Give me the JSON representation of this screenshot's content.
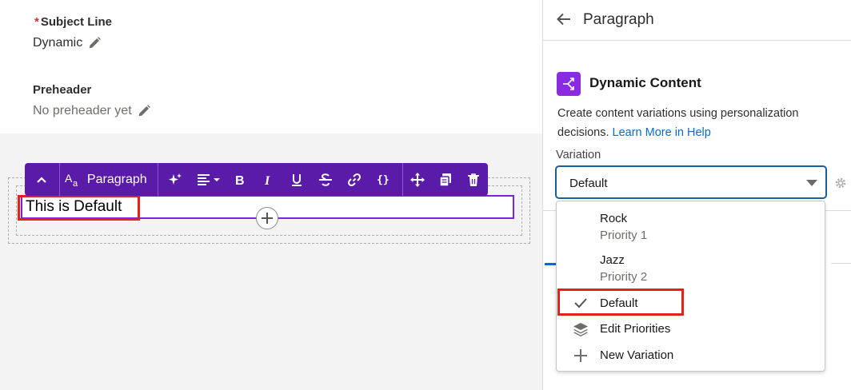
{
  "left": {
    "subject": {
      "required_mark": "*",
      "label": "Subject Line",
      "value": "Dynamic"
    },
    "preheader": {
      "label": "Preheader",
      "value": "No preheader yet"
    },
    "text_block": {
      "content": "This is Default"
    },
    "toolbar": {
      "paragraph_label": "Paragraph",
      "icons": [
        "chevron-up-icon",
        "text-size-icon",
        "sparkle-icon",
        "align-icon",
        "bold-icon",
        "italic-icon",
        "underline-icon",
        "strikethrough-icon",
        "link-icon",
        "merge-field-icon",
        "move-icon",
        "copy-icon",
        "delete-icon"
      ]
    }
  },
  "right": {
    "panel_title": "Paragraph",
    "dynamic_content": {
      "title": "Dynamic Content",
      "description": "Create content variations using personalization decisions.",
      "link": "Learn More in Help"
    },
    "variation": {
      "label": "Variation",
      "selected": "Default"
    },
    "dropdown": {
      "items": [
        {
          "label": "Rock",
          "sub": "Priority 1"
        },
        {
          "label": "Jazz",
          "sub": "Priority 2"
        },
        {
          "label": "Default",
          "selected": true
        },
        {
          "label": "Edit Priorities",
          "icon": "layers-icon"
        },
        {
          "label": "New Variation",
          "icon": "plus-icon"
        }
      ]
    }
  },
  "colors": {
    "toolbar": "#5a1ba9",
    "accent_blue": "#0b6bcb",
    "highlight_red": "#e2231a",
    "dynamic_icon": "#8a2be2"
  }
}
